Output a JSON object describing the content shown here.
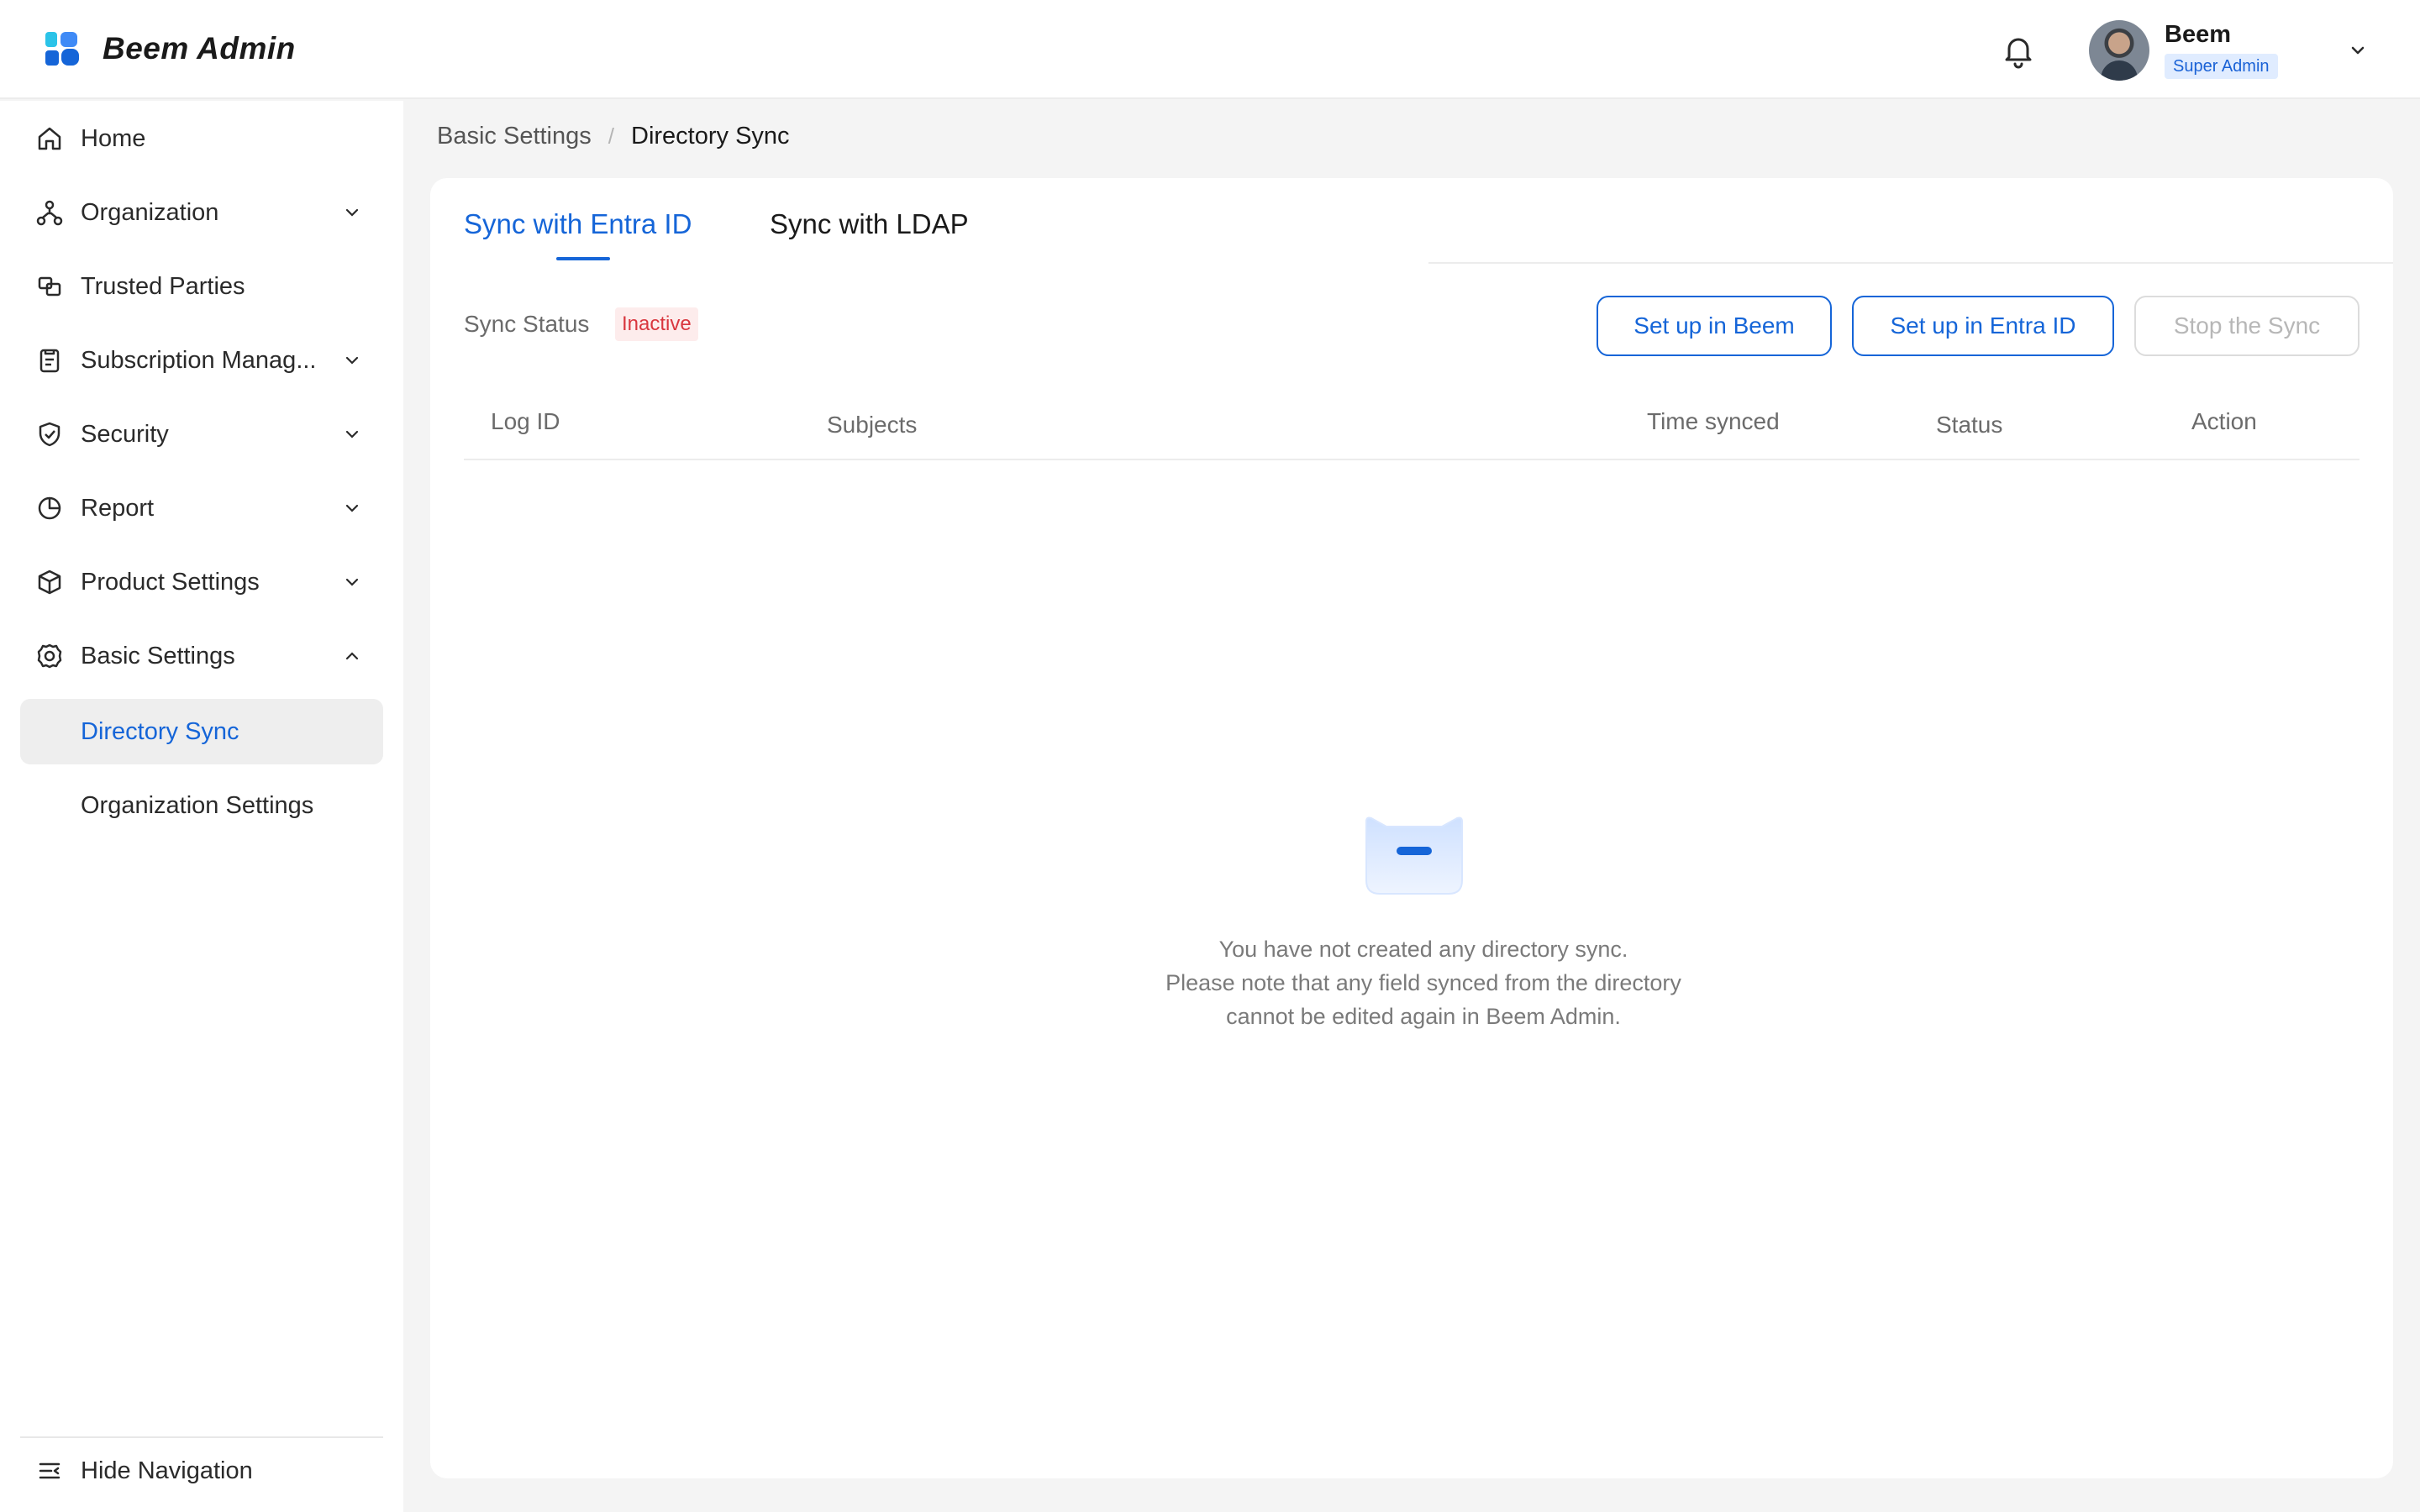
{
  "header": {
    "app_name": "Beem Admin",
    "user_name": "Beem",
    "user_role": "Super Admin"
  },
  "sidebar": {
    "items": [
      {
        "label": "Home",
        "icon": "home-icon"
      },
      {
        "label": "Organization",
        "icon": "organization-icon",
        "expandable": true
      },
      {
        "label": "Trusted Parties",
        "icon": "trusted-parties-icon"
      },
      {
        "label": "Subscription Manag...",
        "icon": "clipboard-icon",
        "expandable": true
      },
      {
        "label": "Security",
        "icon": "shield-icon",
        "expandable": true
      },
      {
        "label": "Report",
        "icon": "pie-chart-icon",
        "expandable": true
      },
      {
        "label": "Product Settings",
        "icon": "box-icon",
        "expandable": true
      },
      {
        "label": "Basic Settings",
        "icon": "gear-icon",
        "expanded": true
      }
    ],
    "sub_items": [
      {
        "label": "Directory Sync",
        "active": true
      },
      {
        "label": "Organization Settings",
        "active": false
      }
    ],
    "hide_nav_label": "Hide Navigation"
  },
  "breadcrumb": {
    "parent": "Basic Settings",
    "separator": "/",
    "current": "Directory Sync"
  },
  "tabs": [
    {
      "label": "Sync with Entra ID",
      "active": true
    },
    {
      "label": "Sync with LDAP",
      "active": false
    }
  ],
  "sync": {
    "status_label": "Sync Status",
    "status_value": "Inactive"
  },
  "actions": {
    "setup_beem": "Set up in Beem",
    "setup_entra": "Set up in Entra ID",
    "stop_sync": "Stop the Sync"
  },
  "table": {
    "columns": [
      "Log ID",
      "Subjects",
      "Time synced",
      "Status",
      "Action"
    ],
    "rows": []
  },
  "empty_state": {
    "lines": [
      "You have not created any directory sync.",
      "Please note that any field synced from the directory",
      "cannot be edited again in Beem Admin."
    ]
  },
  "colors": {
    "accent": "#1565d8",
    "inactive": "#d9363e",
    "active_nav_bg": "#eeeeee"
  }
}
